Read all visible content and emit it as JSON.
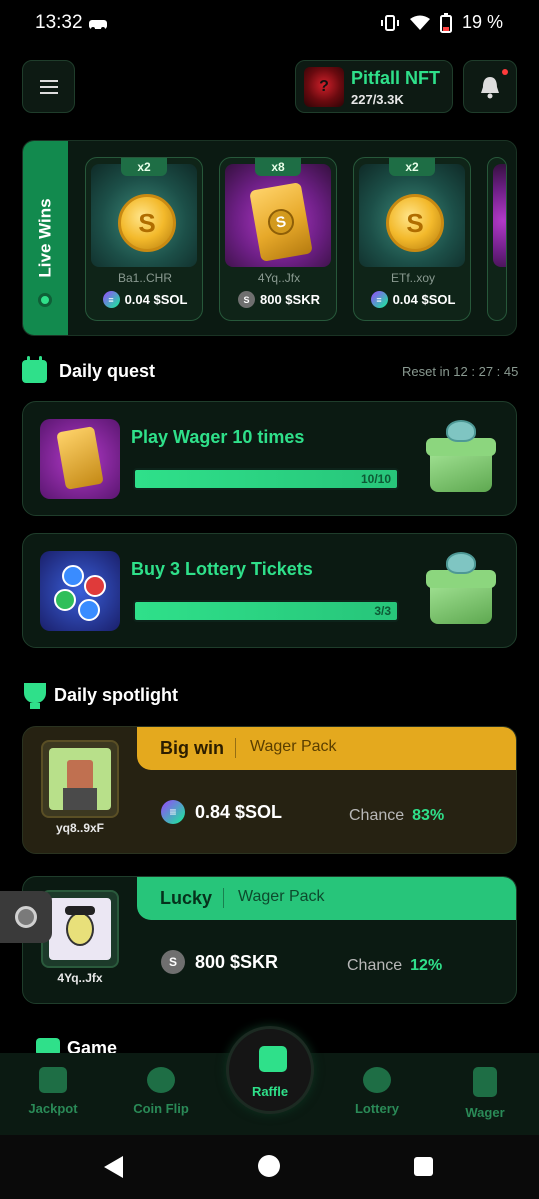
{
  "status_bar": {
    "time": "13:32",
    "battery": "19 %"
  },
  "header": {
    "nft": {
      "title": "Pitfall NFT",
      "count": "227/3.3K",
      "thumb_symbol": "?"
    }
  },
  "live_wins": {
    "label": "Live Wins",
    "cards": [
      {
        "multiplier": "x2",
        "image": "sol-coin",
        "user": "Ba1..CHR",
        "amount": "0.04 $SOL",
        "token": "sol"
      },
      {
        "multiplier": "x8",
        "image": "skr-pack",
        "user": "4Yq..Jfx",
        "amount": "800 $SKR",
        "token": "skr"
      },
      {
        "multiplier": "x2",
        "image": "sol-coin",
        "user": "ETf..xoy",
        "amount": "0.04 $SOL",
        "token": "sol"
      }
    ]
  },
  "daily_quest": {
    "title": "Daily quest",
    "reset_label": "Reset in 12 : 27 : 45",
    "quests": [
      {
        "title": "Play Wager 10 times",
        "progress_text": "10/10",
        "progress": 1.0,
        "image": "pack"
      },
      {
        "title": "Buy 3 Lottery Tickets",
        "progress_text": "3/3",
        "progress": 1.0,
        "image": "lottery-balls"
      }
    ]
  },
  "daily_spotlight": {
    "title": "Daily spotlight",
    "cards": [
      {
        "kind": "Big win",
        "pack": "Wager Pack",
        "user": "yq8..9xF",
        "amount": "0.84 $SOL",
        "token": "sol",
        "chance_label": "Chance",
        "chance": "83%"
      },
      {
        "kind": "Lucky",
        "pack": "Wager Pack",
        "user": "4Yq..Jfx",
        "amount": "800 $SKR",
        "token": "skr",
        "chance_label": "Chance",
        "chance": "12%"
      }
    ]
  },
  "game_section_title": "Game",
  "bottom_nav": {
    "items": [
      "Jackpot",
      "Coin Flip",
      "Lottery",
      "Wager"
    ],
    "center": "Raffle"
  },
  "colors": {
    "accent": "#2fe08a",
    "gold": "#e4a91e",
    "panel": "#0b1a12"
  }
}
